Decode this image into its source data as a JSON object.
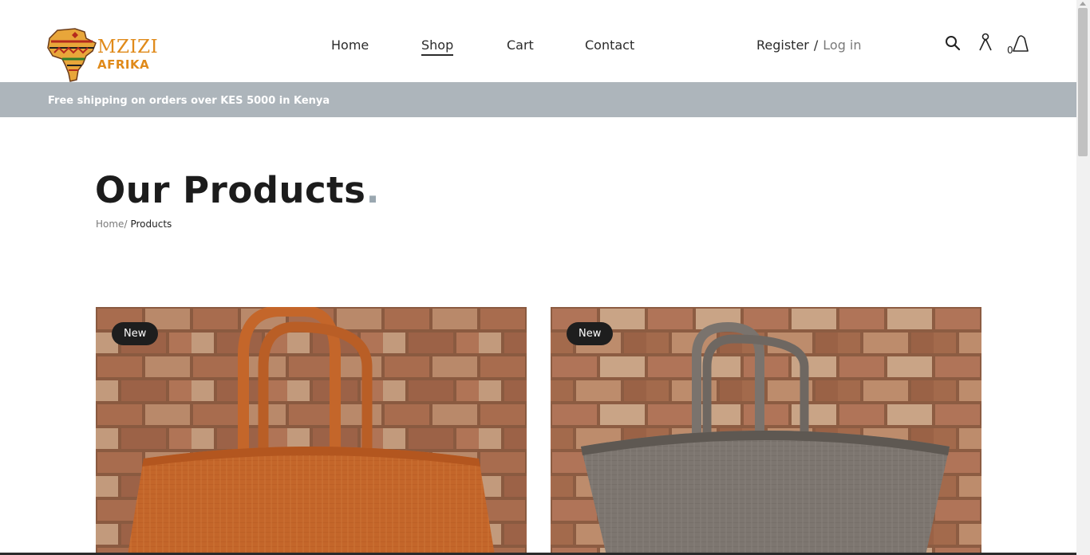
{
  "brand": {
    "name_line1": "MZIZI",
    "name_line2": "AFRIKA"
  },
  "nav": {
    "items": [
      {
        "label": "Home",
        "active": false
      },
      {
        "label": "Shop",
        "active": true
      },
      {
        "label": "Cart",
        "active": false
      },
      {
        "label": "Contact",
        "active": false
      }
    ]
  },
  "auth": {
    "register_label": "Register",
    "separator": "/",
    "login_label": "Log in"
  },
  "header_icons": [
    "search-icon",
    "account-icon",
    "cart-icon"
  ],
  "cart": {
    "count": "0"
  },
  "banner": {
    "text": "Free shipping on orders over KES 5000 in Kenya"
  },
  "page": {
    "title": "Our Products",
    "title_suffix": ".",
    "breadcrumb": {
      "home": "Home/",
      "current": "Products"
    }
  },
  "products": [
    {
      "badge": "New",
      "basket_color": "#c4662a"
    },
    {
      "badge": "New",
      "basket_color": "#7d7670"
    }
  ],
  "colors": {
    "banner_bg": "#adb5bb",
    "badge_bg": "#1e1e1e",
    "accent_dot": "#9aa7b0",
    "brand_orange": "#e08a1a"
  }
}
